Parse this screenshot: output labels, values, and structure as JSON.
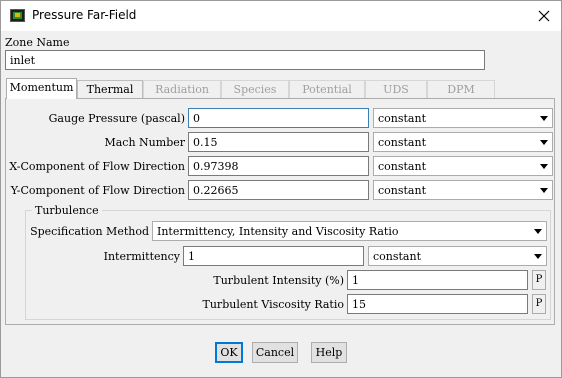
{
  "window": {
    "title": "Pressure Far-Field"
  },
  "zone": {
    "label": "Zone Name",
    "value": "inlet"
  },
  "tabs": [
    {
      "label": "Momentum",
      "state": "active"
    },
    {
      "label": "Thermal",
      "state": "enabled"
    },
    {
      "label": "Radiation",
      "state": "disabled"
    },
    {
      "label": "Species",
      "state": "disabled"
    },
    {
      "label": "Potential",
      "state": "disabled"
    },
    {
      "label": "UDS",
      "state": "disabled"
    },
    {
      "label": "DPM",
      "state": "disabled"
    }
  ],
  "momentum": {
    "gauge_pressure": {
      "label": "Gauge Pressure (pascal)",
      "value": "0",
      "method": "constant"
    },
    "mach_number": {
      "label": "Mach Number",
      "value": "0.15",
      "method": "constant"
    },
    "x_direction": {
      "label": "X-Component of Flow Direction",
      "value": "0.97398",
      "method": "constant"
    },
    "y_direction": {
      "label": "Y-Component of Flow Direction",
      "value": "0.22665",
      "method": "constant"
    }
  },
  "turbulence": {
    "group_label": "Turbulence",
    "spec_method": {
      "label": "Specification Method",
      "value": "Intermittency, Intensity and Viscosity Ratio"
    },
    "intermittency": {
      "label": "Intermittency",
      "value": "1",
      "method": "constant"
    },
    "intensity": {
      "label": "Turbulent Intensity (%)",
      "value": "1",
      "param": "P"
    },
    "viscosity_ratio": {
      "label": "Turbulent Viscosity Ratio",
      "value": "15",
      "param": "P"
    }
  },
  "buttons": {
    "ok": "OK",
    "cancel": "Cancel",
    "help": "Help"
  },
  "icons": {
    "app": "fluent-app-icon",
    "close": "close-icon",
    "dropdown": "chevron-down-icon"
  },
  "colors": {
    "focus_border": "#3c7fb1",
    "default_button": "#0078d7"
  }
}
